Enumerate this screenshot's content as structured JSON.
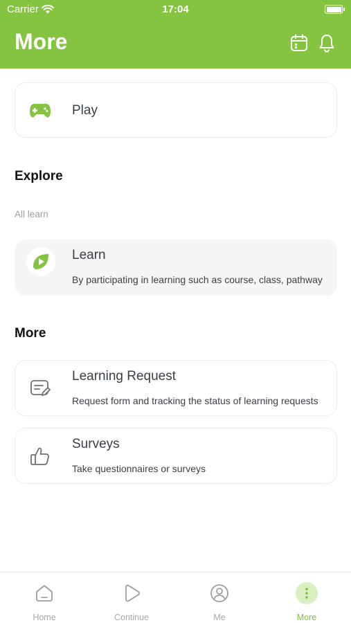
{
  "status_bar": {
    "carrier": "Carrier",
    "time": "17:04"
  },
  "header": {
    "title": "More",
    "icons": [
      "calendar-icon",
      "bell-icon"
    ]
  },
  "play": {
    "label": "Play",
    "icon": "gamepad-icon"
  },
  "explore": {
    "title": "Explore",
    "subtitle": "All learn",
    "learn": {
      "title": "Learn",
      "description": "By participating in learning such as course, class, pathway",
      "icon": "play-leaf-icon"
    }
  },
  "more": {
    "title": "More",
    "items": [
      {
        "title": "Learning Request",
        "description": "Request form and tracking the status of learning requests",
        "icon": "edit-form-icon"
      },
      {
        "title": "Surveys",
        "description": "Take questionnaires or surveys",
        "icon": "thumbs-up-icon"
      }
    ]
  },
  "tabs": [
    {
      "label": "Home",
      "icon": "home-icon",
      "active": false
    },
    {
      "label": "Continue",
      "icon": "play-outline-icon",
      "active": false
    },
    {
      "label": "Me",
      "icon": "user-icon",
      "active": false
    },
    {
      "label": "More",
      "icon": "more-vertical-icon",
      "active": true
    }
  ],
  "colors": {
    "brand": "#84c441",
    "active_tab": "#7cc03a",
    "card_gray": "#f5f5f5"
  }
}
